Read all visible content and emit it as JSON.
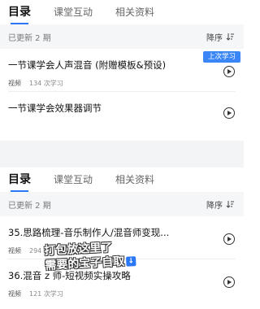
{
  "top": {
    "tabs": [
      "目录",
      "课堂互动",
      "相关资料"
    ],
    "status": "已更新 2 期",
    "sort_label": "降序",
    "last_badge": "上次学习",
    "lessons": [
      {
        "title": "一节课学会人声混音 (附赠模板&预设)",
        "type": "视频",
        "count": "134 次学习"
      },
      {
        "title": "一节课学会效果器调节",
        "type": "",
        "count": ""
      }
    ]
  },
  "bottom": {
    "tabs": [
      "目录",
      "课堂互动",
      "相关资料"
    ],
    "status": "已更新 2 期",
    "sort_label": "降序",
    "lessons": [
      {
        "title": "35.思路梳理-音乐制作人/混音师变现...",
        "type": "视频",
        "count": "294 次"
      },
      {
        "title": "36.混音 z 师-短视频实操攻略",
        "type": "视频",
        "count": "121 次学习"
      }
    ]
  },
  "overlay": {
    "line1": "打包放这里了",
    "line2": "需要的宝子自取",
    "icon": "download-icon"
  },
  "colors": {
    "accent": "#2b78f6",
    "badge": "#3b86f7"
  }
}
